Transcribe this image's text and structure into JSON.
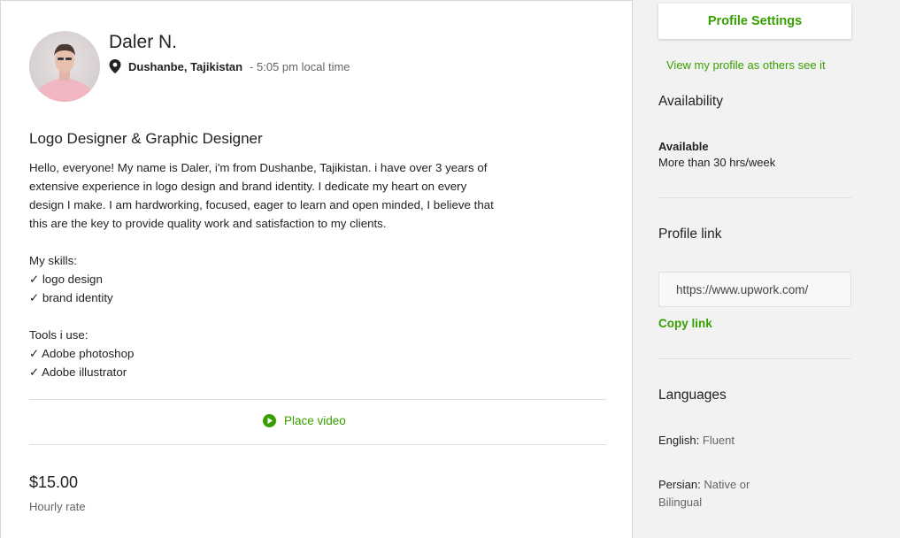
{
  "profile": {
    "name": "Daler N.",
    "location": "Dushanbe, Tajikistan",
    "local_time": "- 5:05 pm local time",
    "title": "Logo Designer & Graphic Designer",
    "overview": {
      "intro_lines": [
        "Hello, everyone! My name is Daler, i'm from Dushanbe, Tajikistan. i have over 3 years of",
        "extensive experience in logo design and brand identity. I dedicate my heart on every",
        "design I make. I am hardworking, focused, eager to learn and open minded, I believe that",
        "this are the key to provide quality work and satisfaction to my clients."
      ],
      "skills_heading": "My skills:",
      "skills": [
        "✓ logo design",
        "✓ brand identity"
      ],
      "tools_heading": "Tools i use:",
      "tools": [
        "✓ Adobe photoshop",
        "✓ Adobe illustrator"
      ]
    },
    "place_video_label": "Place video",
    "hourly_rate": "$15.00",
    "hourly_rate_label": "Hourly rate"
  },
  "sidebar": {
    "settings_button": "Profile Settings",
    "view_as_link": "View my profile as others see it",
    "availability_heading": "Availability",
    "availability_status": "Available",
    "availability_detail": "More than 30 hrs/week",
    "profile_link_heading": "Profile link",
    "profile_link_value": "https://www.upwork.com/",
    "copy_link_label": "Copy link",
    "languages_heading": "Languages",
    "languages": [
      {
        "name": "English:",
        "level": "Fluent"
      },
      {
        "name": "Persian:",
        "level": "Native or Bilingual"
      }
    ]
  },
  "colors": {
    "accent_green": "#37a000",
    "sidebar_bg": "#f2f2f2"
  },
  "icons": {
    "location": "map-pin-icon",
    "video": "play-circle-icon",
    "avatar": "avatar-photo"
  }
}
